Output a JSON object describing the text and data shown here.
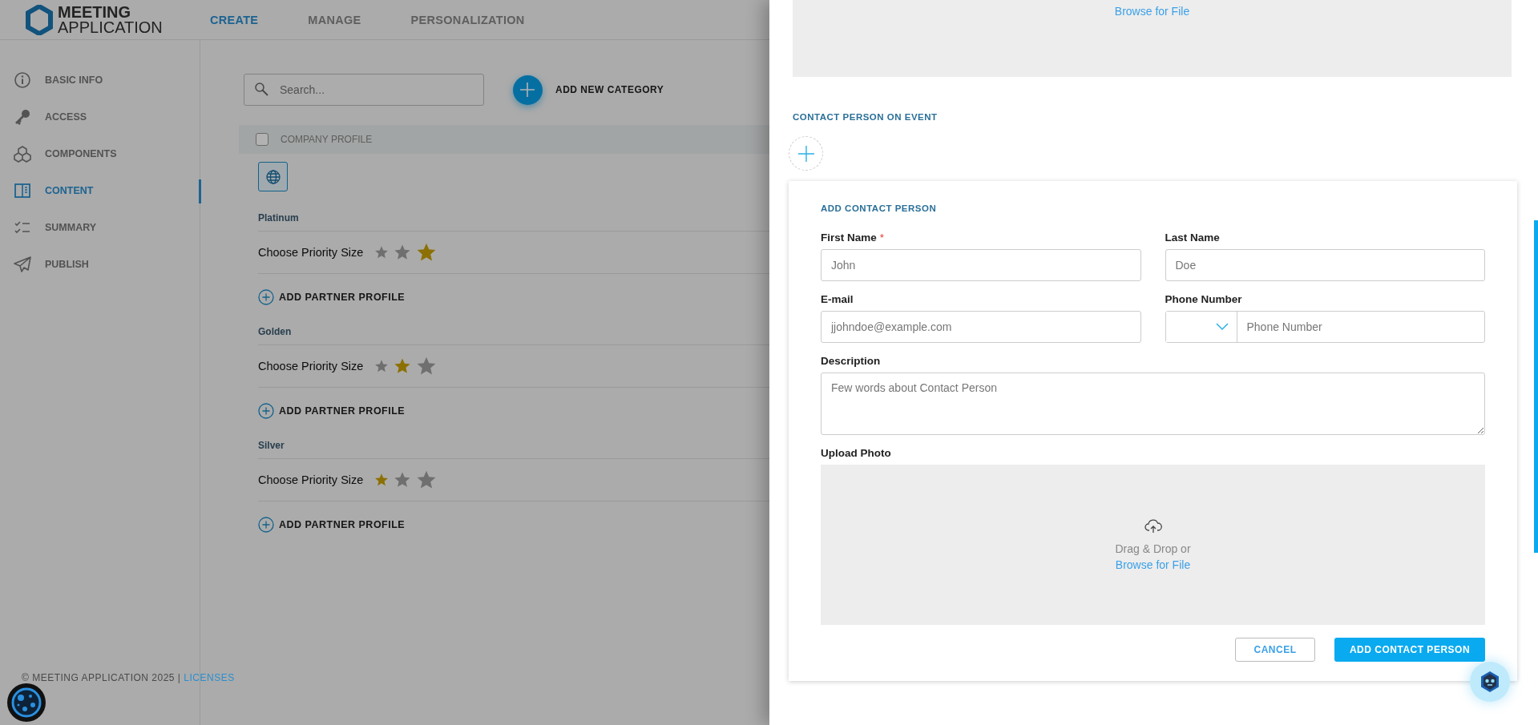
{
  "header": {
    "logo_line_1": "MEETING",
    "logo_line_2": "APPLICATION",
    "nav": [
      {
        "label": "CREATE",
        "selected": true
      },
      {
        "label": "MANAGE",
        "selected": false
      },
      {
        "label": "PERSONALIZATION",
        "selected": false
      }
    ]
  },
  "sidebar": {
    "items": [
      {
        "label": "BASIC INFO",
        "selected": false
      },
      {
        "label": "ACCESS",
        "selected": false
      },
      {
        "label": "COMPONENTS",
        "selected": false
      },
      {
        "label": "CONTENT",
        "selected": true
      },
      {
        "label": "SUMMARY",
        "selected": false
      },
      {
        "label": "PUBLISH",
        "selected": false
      }
    ]
  },
  "footer": {
    "copyright": "© MEETING APPLICATION 2025 |",
    "link": "LICENSES"
  },
  "content": {
    "search": {
      "placeholder": "Search..."
    },
    "add_category": "ADD NEW CATEGORY",
    "table_header": {
      "label": "COMPANY PROFILE",
      "checked": false
    },
    "categories": [
      {
        "name": "Platinum",
        "priority_label": "Choose Priority Size",
        "priority_options": [
          {
            "selected": false
          },
          {
            "selected": false
          },
          {
            "selected": true
          }
        ],
        "add_partner": "ADD PARTNER PROFILE"
      },
      {
        "name": "Golden",
        "priority_label": "Choose Priority Size",
        "priority_options": [
          {
            "selected": false
          },
          {
            "selected": true
          },
          {
            "selected": false
          }
        ],
        "add_partner": "ADD PARTNER PROFILE"
      },
      {
        "name": "Silver",
        "priority_label": "Choose Priority Size",
        "priority_options": [
          {
            "selected": true
          },
          {
            "selected": false
          },
          {
            "selected": false
          }
        ],
        "add_partner": "ADD PARTNER PROFILE"
      }
    ]
  },
  "drawer": {
    "top_dropzone": {
      "link": "Browse for File"
    },
    "section_title": "CONTACT PERSON ON EVENT",
    "form": {
      "title": "ADD CONTACT PERSON",
      "fields": [
        {
          "kind": "text",
          "label": "First Name",
          "required_mark": "*",
          "placeholder": "John"
        },
        {
          "kind": "text",
          "label": "Last Name",
          "placeholder": "Doe"
        },
        {
          "kind": "text",
          "label": "E-mail",
          "placeholder": "jjohndoe@example.com"
        },
        {
          "kind": "phone",
          "label": "Phone Number",
          "placeholder": "Phone Number"
        },
        {
          "kind": "textarea",
          "label": "Description",
          "placeholder": "Few words about Contact Person"
        },
        {
          "kind": "upload",
          "label": "Upload Photo",
          "hint": "Drag & Drop or",
          "link": "Browse for File"
        }
      ],
      "buttons": [
        {
          "kind": "secondary",
          "label": "CANCEL"
        },
        {
          "kind": "primary",
          "label": "ADD CONTACT PERSON"
        }
      ]
    }
  }
}
